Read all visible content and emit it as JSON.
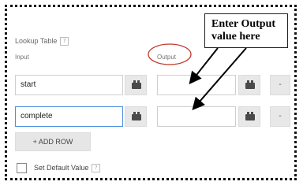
{
  "lookup_table": {
    "title": "Lookup Table",
    "help_icon": "?",
    "input_header": "Input",
    "output_header": "Output",
    "rows": [
      {
        "input": "start",
        "output": "",
        "remove_label": "-"
      },
      {
        "input": "complete",
        "output": "",
        "remove_label": "-"
      }
    ],
    "add_row_label": "+ ADD ROW",
    "default_value_label": "Set Default Value",
    "default_value_checked": false,
    "default_help_icon": "?"
  },
  "annotation": {
    "callout_text": "Enter Output value here",
    "circle_color": "#c0392b",
    "arrow_color": "#000000"
  },
  "icons": {
    "variable_button": "lego-brick-icon",
    "help": "question-mark-icon"
  }
}
